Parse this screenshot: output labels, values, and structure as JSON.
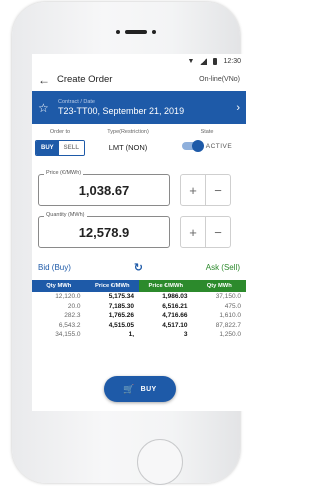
{
  "status": {
    "time": "12:30"
  },
  "header": {
    "title": "Create Order",
    "mode": "On-line(VNo)"
  },
  "contract": {
    "caption": "Contract / Date",
    "value": "T23-TT00, September 21, 2019"
  },
  "order": {
    "order_to_caption": "Order to",
    "buy_label": "BUY",
    "sell_label": "SELL",
    "selected_side": "BUY",
    "restriction_caption": "Type(Restriction)",
    "restriction_value": "LMT (NON)",
    "state_caption": "State",
    "state_value": "ACTIVE"
  },
  "price": {
    "label": "Price (€/MWh)",
    "value": "1,038.67",
    "plus": "+",
    "minus": "−"
  },
  "quantity": {
    "label": "Quantity (MWh)",
    "value": "12,578.9",
    "plus": "+",
    "minus": "−"
  },
  "book": {
    "bid_title": "Bid (Buy)",
    "ask_title": "Ask (Sell)",
    "bid_headers": [
      "Qty MWh",
      "Price €/MWh"
    ],
    "ask_headers": [
      "Price €/MWh",
      "Qty MWh"
    ],
    "bids": [
      [
        "12,120.0",
        "5,175.34"
      ],
      [
        "20.0",
        "7,185.30"
      ],
      [
        "282.3",
        "1,765.26"
      ],
      [
        "6,543.2",
        "4,515.05"
      ],
      [
        "34,155.0",
        "1,"
      ]
    ],
    "asks": [
      [
        "1,986.03",
        "37,150.0"
      ],
      [
        "6,516.21",
        "475.0"
      ],
      [
        "4,716.66",
        "1,610.0"
      ],
      [
        "4,517.10",
        "87,822.7"
      ],
      [
        "3",
        "1,250.0"
      ]
    ]
  },
  "fab": {
    "label": "BUY"
  },
  "colors": {
    "primary": "#1e5aa8",
    "ask": "#2c8a2c"
  }
}
